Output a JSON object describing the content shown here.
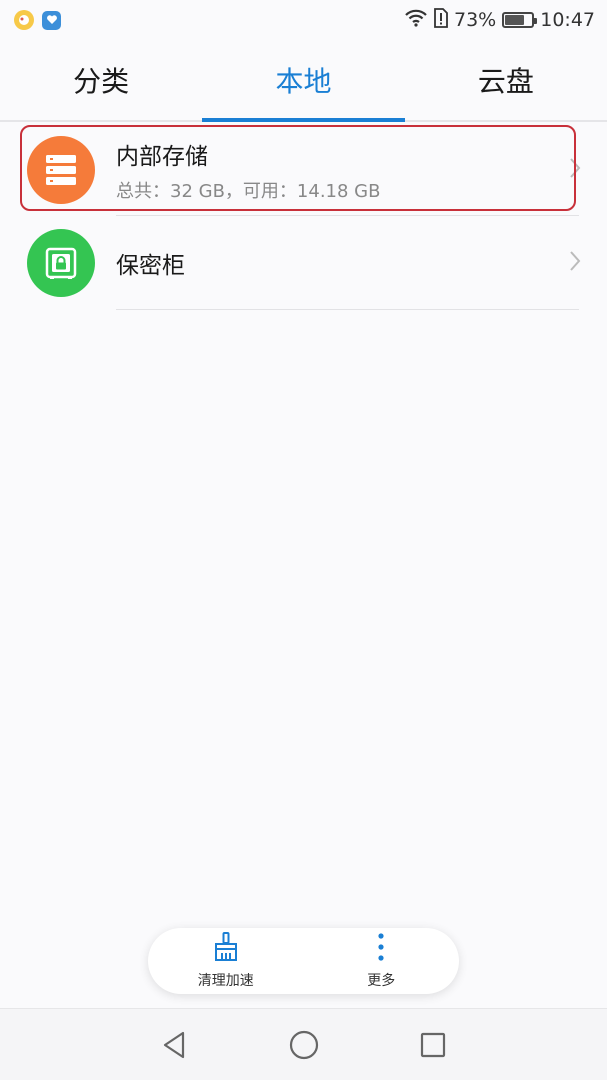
{
  "status_bar": {
    "battery_percent": "73%",
    "battery_level": 0.73,
    "time": "10:47"
  },
  "tabs": [
    {
      "label": "分类",
      "active": false
    },
    {
      "label": "本地",
      "active": true
    },
    {
      "label": "云盘",
      "active": false
    }
  ],
  "items": [
    {
      "title": "内部存储",
      "subtitle": "总共：32 GB，可用：14.18 GB",
      "icon": "storage-icon",
      "color": "#f57b3a"
    },
    {
      "title": "保密柜",
      "subtitle": "",
      "icon": "safe-icon",
      "color": "#34c552"
    }
  ],
  "bottom_bar": {
    "clean_label": "清理加速",
    "more_label": "更多",
    "accent": "#1a7fd4"
  },
  "colors": {
    "accent": "#1a7fd4",
    "highlight": "#c8303a"
  }
}
